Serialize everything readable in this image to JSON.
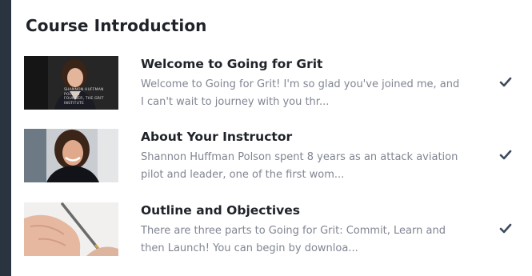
{
  "section": {
    "title": "Course Introduction"
  },
  "lessons": [
    {
      "title": "Welcome to Going for Grit",
      "desc_line1": "Welcome to Going for Grit! I'm so glad you've joined me, and",
      "desc_line2": "I can't wait to journey with you thr...",
      "completed": true,
      "thumb_caption": [
        "SHANNON HUFFMAN",
        "POLSON",
        "FOUNDER, THE GRIT",
        "INSTITUTE"
      ]
    },
    {
      "title": "About Your Instructor",
      "desc_line1": "Shannon Huffman Polson spent 8 years as an attack aviation",
      "desc_line2": "pilot and leader, one of the first wom...",
      "completed": true
    },
    {
      "title": "Outline and Objectives",
      "desc_line1": "There are three parts to Going for Grit: Commit, Learn and",
      "desc_line2": "then Launch! You can begin by downloa...",
      "completed": true
    }
  ],
  "colors": {
    "check": "#3d4a5c",
    "title": "#1f2329",
    "desc": "#808591"
  }
}
